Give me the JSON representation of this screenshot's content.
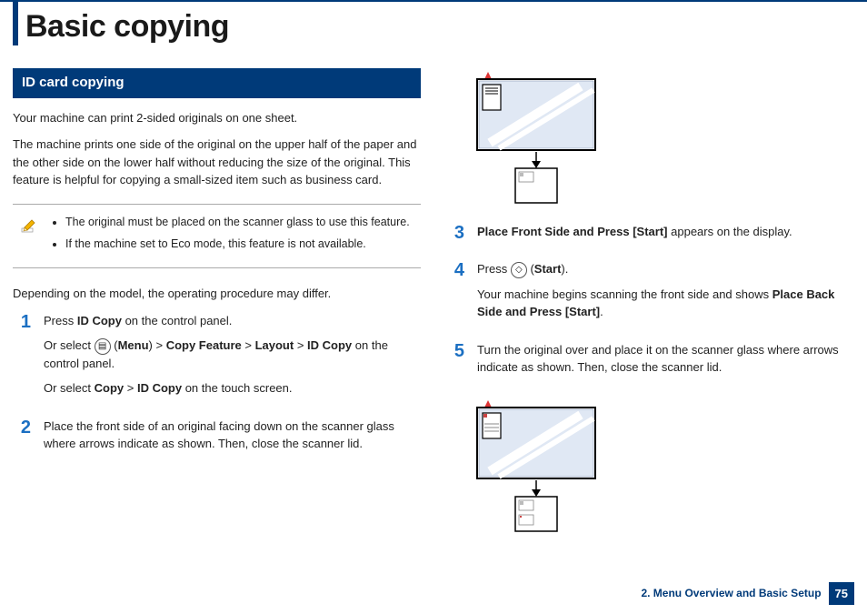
{
  "header": {
    "title": "Basic copying"
  },
  "section": {
    "heading": "ID card copying",
    "intro1": "Your machine can print 2-sided originals on one sheet.",
    "intro2": "The machine prints one side of the original on the upper half of the paper and the other side on the lower half without reducing the size of the original. This feature is helpful for copying a small-sized item such as business card.",
    "note1": "The original must be placed on the scanner glass to use this feature.",
    "note2": "If the machine set to Eco mode, this feature is not available.",
    "depending": "Depending on the model, the operating procedure may differ."
  },
  "steps": {
    "s1a_pre": "Press ",
    "s1a_b": "ID Copy",
    "s1a_post": " on the control panel.",
    "s1b_pre": "Or select ",
    "s1b_open": " (",
    "s1b_menu": "Menu",
    "s1b_sep": ") > ",
    "s1b_feat": "Copy Feature",
    "s1b_gt": " > ",
    "s1b_layout": "Layout",
    "s1b_id": "ID Copy",
    "s1b_post": " on the control panel.",
    "s1c_pre": "Or select ",
    "s1c_copy": "Copy",
    "s1c_gt": " > ",
    "s1c_id": "ID Copy",
    "s1c_post": " on the touch screen.",
    "s2": "Place the front side of an original facing down on the scanner glass where arrows indicate as shown. Then, close the scanner lid.",
    "s3b": "Place Front Side and Press [Start]",
    "s3post": " appears on the display.",
    "s4a_pre": "Press ",
    "s4a_open": " (",
    "s4a_start": "Start",
    "s4a_close": ").",
    "s4b_pre": "Your machine begins scanning the front side and shows ",
    "s4b_bold": "Place Back Side and Press [Start]",
    "s4b_post": ".",
    "s5": "Turn the original over and place it on the scanner glass where arrows indicate as shown. Then, close the scanner lid."
  },
  "nums": {
    "1": "1",
    "2": "2",
    "3": "3",
    "4": "4",
    "5": "5"
  },
  "footer": {
    "chapter": "2. Menu Overview and Basic Setup",
    "page": "75"
  }
}
